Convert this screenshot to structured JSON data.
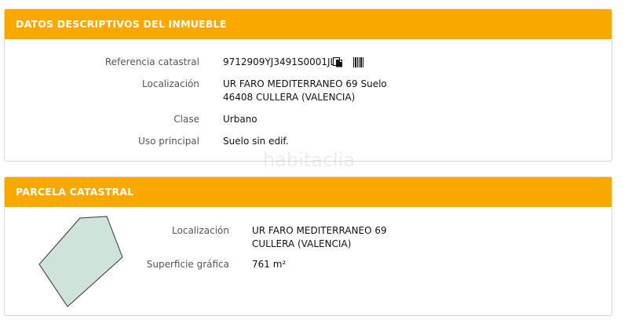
{
  "panel_property": {
    "title": "DATOS DESCRIPTIVOS DEL INMUEBLE",
    "rows": [
      {
        "label": "Referencia catastral",
        "value": "9712909YJ3491S0001JL"
      },
      {
        "label": "Localización",
        "value_line1": "UR FARO MEDITERRANEO 69 Suelo",
        "value_line2": "46408 CULLERA (VALENCIA)"
      },
      {
        "label": "Clase",
        "value": "Urbano"
      },
      {
        "label": "Uso principal",
        "value": "Suelo sin edif."
      }
    ],
    "icons": [
      "copy-icon",
      "barcode-icon"
    ]
  },
  "panel_parcel": {
    "title": "PARCELA CATASTRAL",
    "rows": [
      {
        "label": "Localización",
        "value_line1": "UR FARO MEDITERRANEO 69",
        "value_line2": "CULLERA (VALENCIA)"
      },
      {
        "label": "Superficie gráfica",
        "value": "761 m²"
      }
    ],
    "parcel_fill": "#cfe3da",
    "parcel_stroke": "#333333"
  },
  "watermark": "habitaclia",
  "colors": {
    "header_bg": "#f9a800",
    "header_text": "#ffffff",
    "border": "#d6d6d6"
  }
}
